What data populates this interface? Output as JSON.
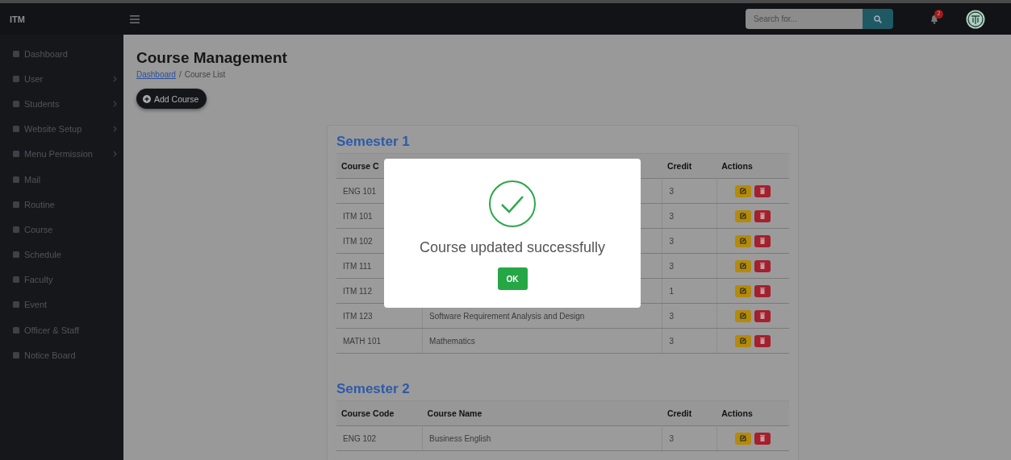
{
  "topbar": {
    "brand": "ITM",
    "search": {
      "placeholder": "Search for..."
    },
    "notification_count": "2"
  },
  "sidebar": {
    "items": [
      {
        "label": "Dashboard",
        "has_submenu": false
      },
      {
        "label": "User",
        "has_submenu": true
      },
      {
        "label": "Students",
        "has_submenu": true
      },
      {
        "label": "Website Setup",
        "has_submenu": true
      },
      {
        "label": "Menu Permission",
        "has_submenu": true
      },
      {
        "label": "Mail",
        "has_submenu": false
      },
      {
        "label": "Routine",
        "has_submenu": false
      },
      {
        "label": "Course",
        "has_submenu": false
      },
      {
        "label": "Schedule",
        "has_submenu": false
      },
      {
        "label": "Faculty",
        "has_submenu": false
      },
      {
        "label": "Event",
        "has_submenu": false
      },
      {
        "label": "Officer & Staff",
        "has_submenu": false
      },
      {
        "label": "Notice Board",
        "has_submenu": false
      }
    ]
  },
  "page": {
    "title": "Course Management",
    "breadcrumb": {
      "link": "Dashboard",
      "separator": "/",
      "current": "Course List"
    },
    "add_button": "Add Course"
  },
  "semesters": [
    {
      "title": "Semester 1",
      "columns": [
        {
          "label": "Course C"
        },
        {},
        {
          "label": "Credit"
        },
        {
          "label": "Actions"
        }
      ],
      "rows": [
        {
          "code": "ENG 101",
          "credit": "3"
        },
        {
          "code": "ITM 101",
          "credit": "3"
        },
        {
          "code": "ITM 102",
          "credit": "3"
        },
        {
          "code": "ITM 111",
          "credit": "3"
        },
        {
          "code": "ITM 112",
          "credit": "1"
        },
        {
          "code": "ITM 123",
          "name": "Software Requirement Analysis and Design",
          "credit": "3"
        },
        {
          "code": "MATH 101",
          "name": "Mathematics",
          "credit": "3"
        }
      ]
    },
    {
      "title": "Semester 2",
      "columns": [
        {
          "label": "Course Code"
        },
        {
          "label": "Course Name"
        },
        {
          "label": "Credit"
        },
        {
          "label": "Actions"
        }
      ],
      "rows": [
        {
          "code": "ENG 102",
          "name": "Business English",
          "credit": "3"
        }
      ]
    }
  ],
  "modal": {
    "message": "Course updated successfully",
    "button": "OK"
  }
}
